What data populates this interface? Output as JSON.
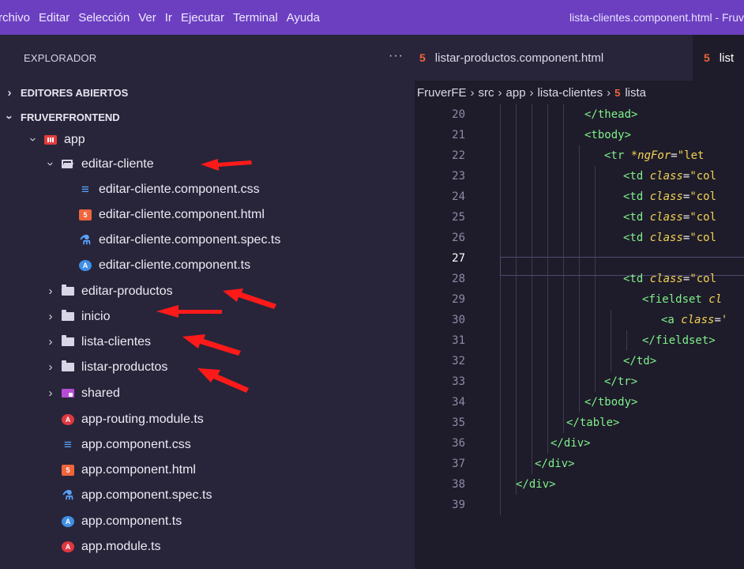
{
  "menubar": {
    "items": [
      "rchivo",
      "Editar",
      "Selección",
      "Ver",
      "Ir",
      "Ejecutar",
      "Terminal",
      "Ayuda"
    ],
    "window_title": "lista-clientes.component.html - Fruv"
  },
  "sidebar": {
    "title": "EXPLORADOR",
    "more_actions": "···",
    "sections": {
      "open_editors": "EDITORES ABIERTOS",
      "project": "FRUVERFRONTEND"
    },
    "tree": [
      {
        "label": "app",
        "icon": "angular-folder-icon"
      },
      {
        "label": "editar-cliente",
        "icon": "folder-open-icon"
      },
      {
        "label": "editar-cliente.component.css",
        "icon": "css-file-icon"
      },
      {
        "label": "editar-cliente.component.html",
        "icon": "html-file-icon"
      },
      {
        "label": "editar-cliente.component.spec.ts",
        "icon": "test-file-icon"
      },
      {
        "label": "editar-cliente.component.ts",
        "icon": "angular-component-icon"
      },
      {
        "label": "editar-productos",
        "icon": "folder-icon"
      },
      {
        "label": "inicio",
        "icon": "folder-icon"
      },
      {
        "label": "lista-clientes",
        "icon": "folder-icon"
      },
      {
        "label": "listar-productos",
        "icon": "folder-icon"
      },
      {
        "label": "shared",
        "icon": "shared-folder-icon"
      },
      {
        "label": "app-routing.module.ts",
        "icon": "angular-icon"
      },
      {
        "label": "app.component.css",
        "icon": "css-file-icon"
      },
      {
        "label": "app.component.html",
        "icon": "html-file-icon"
      },
      {
        "label": "app.component.spec.ts",
        "icon": "test-file-icon"
      },
      {
        "label": "app.component.ts",
        "icon": "angular-component-icon"
      },
      {
        "label": "app.module.ts",
        "icon": "angular-icon"
      }
    ]
  },
  "editor": {
    "tabs": [
      "listar-productos.component.html",
      "list"
    ],
    "breadcrumb": [
      "FruverFE",
      "src",
      "app",
      "lista-clientes",
      "lista"
    ],
    "line_numbers": [
      "20",
      "21",
      "22",
      "23",
      "24",
      "25",
      "26",
      "27",
      "28",
      "29",
      "30",
      "31",
      "32",
      "33",
      "34",
      "35",
      "36",
      "37",
      "38",
      "39"
    ],
    "current_line": "27",
    "lines": {
      "l20": {
        "tag": "</thead>"
      },
      "l21": {
        "tag": "<tbody>"
      },
      "l22": {
        "tag": "<tr ",
        "attr": "*ngFor",
        "eq": "=",
        "str": "\"let"
      },
      "l23": {
        "tag": "<td ",
        "attr": "class",
        "eq": "=",
        "str": "\"col"
      },
      "l24": {
        "tag": "<td ",
        "attr": "class",
        "eq": "=",
        "str": "\"col"
      },
      "l25": {
        "tag": "<td ",
        "attr": "class",
        "eq": "=",
        "str": "\"col"
      },
      "l26": {
        "tag": "<td ",
        "attr": "class",
        "eq": "=",
        "str": "\"col"
      },
      "l28": {
        "tag": "<td ",
        "attr": "class",
        "eq": "=",
        "str": "\"col"
      },
      "l29": {
        "tag": "<fieldset ",
        "attr": "cl"
      },
      "l30": {
        "tag": "<a ",
        "attr": "class",
        "eq": "=",
        "str": "'"
      },
      "l31": {
        "tag": "</fieldset>"
      },
      "l32": {
        "tag": "</td>"
      },
      "l33": {
        "tag": "</tr>"
      },
      "l34": {
        "tag": "</tbody>"
      },
      "l35": {
        "tag": "</table>"
      },
      "l36": {
        "tag": "</div>"
      },
      "l37": {
        "tag": "</div>"
      },
      "l38": {
        "tag": "</div>"
      }
    }
  },
  "colors": {
    "menubar": "#6c3fc1",
    "sidebar": "#28253a",
    "editor": "#1e1c2a",
    "tag": "#7ff08a",
    "attribute": "#f3d253",
    "annotation_arrow": "#ff1a1a"
  }
}
